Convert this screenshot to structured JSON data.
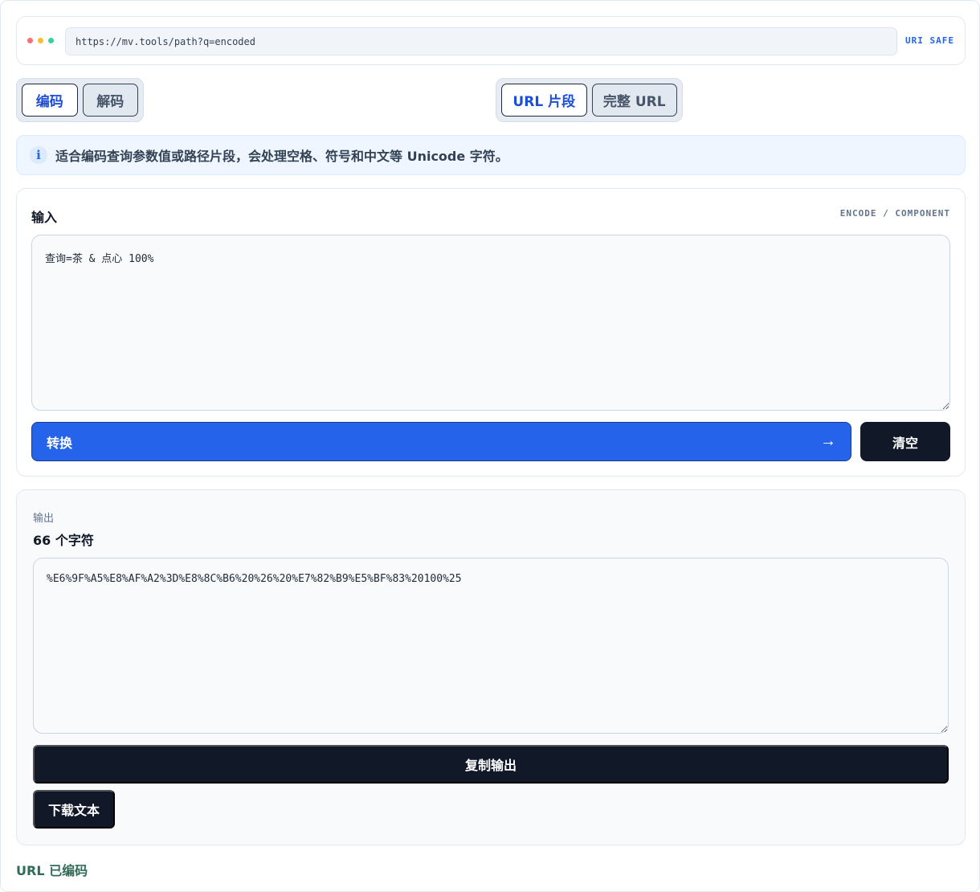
{
  "address_bar": {
    "url": "https://mv.tools/path?q=encoded",
    "badge": "URI SAFE",
    "dot_colors": [
      "#f87171",
      "#fbbf24",
      "#34d399"
    ]
  },
  "mode_switch": {
    "encode_label": "编码",
    "decode_label": "解码",
    "selected": "编码"
  },
  "scope_switch": {
    "component_label": "URL 片段",
    "full_label": "完整 URL",
    "selected": "URL 片段"
  },
  "info": {
    "icon": "info-icon",
    "icon_glyph": "i",
    "text": "适合编码查询参数值或路径片段，会处理空格、符号和中文等 Unicode 字符。"
  },
  "input": {
    "label": "输入",
    "mode_tag": "ENCODE / COMPONENT",
    "value": "查询=茶 & 点心 100%",
    "convert_label": "转换",
    "arrow_glyph": "→",
    "clear_label": "清空"
  },
  "output": {
    "label": "输出",
    "count": "66 个字符",
    "value": "%E6%9F%A5%E8%AF%A2%3D%E8%8C%B6%20%26%20%E7%82%B9%E5%BF%83%20100%25",
    "copy_label": "复制输出",
    "download_label": "下载文本"
  },
  "status": "URL 已编码",
  "colors": {
    "accent": "#2563eb",
    "dark": "#111827",
    "status": "#2f6b57"
  }
}
